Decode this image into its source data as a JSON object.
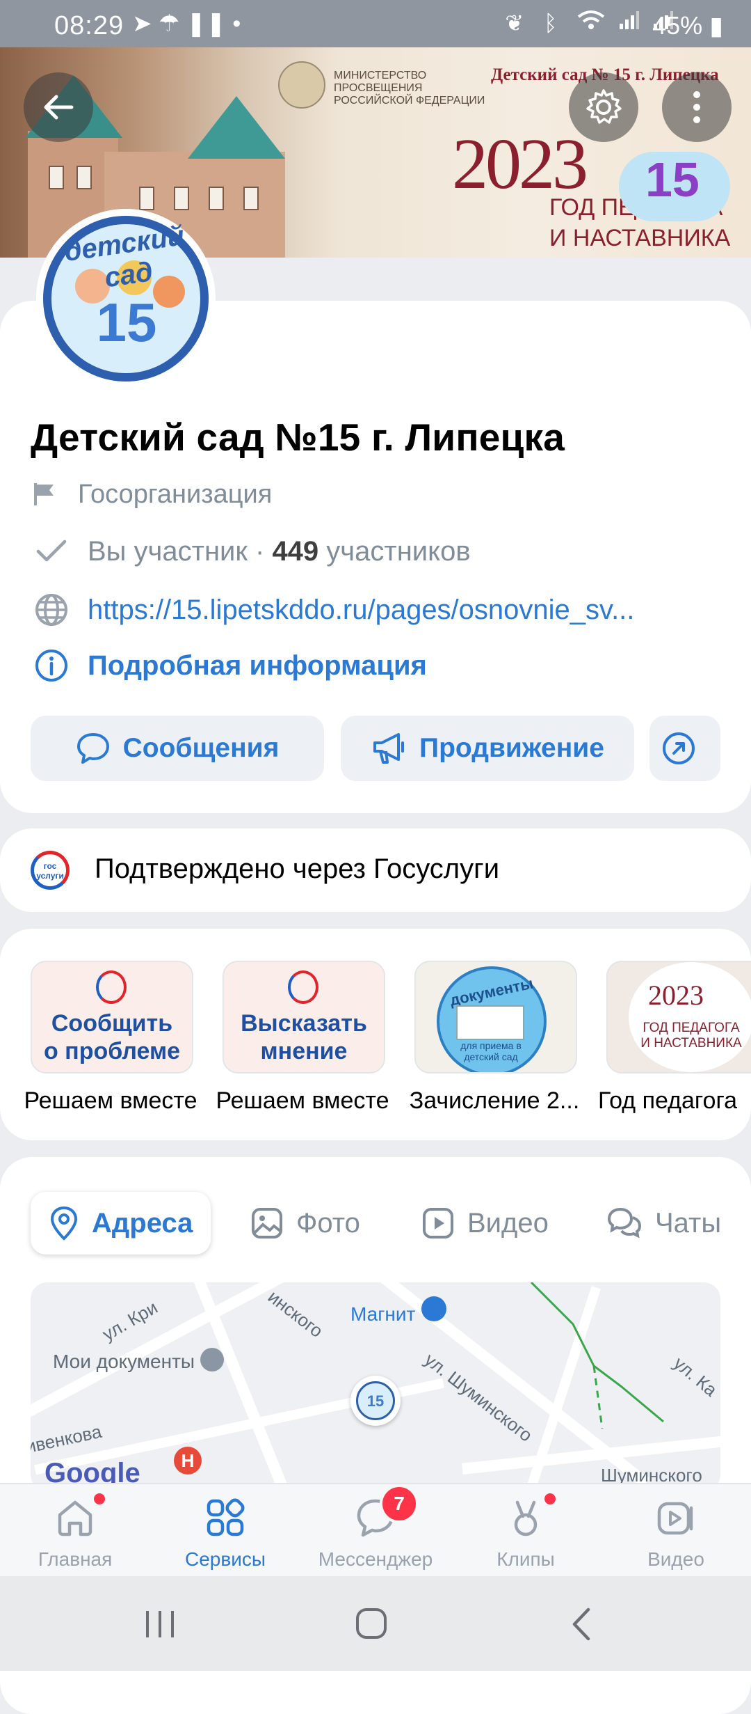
{
  "status_bar": {
    "time": "08:29",
    "battery": "45%",
    "left_icons": [
      "telegram-icon",
      "umbrella-icon",
      "pause-icon",
      "dot-icon"
    ],
    "right_icons": [
      "leaf-icon",
      "bluetooth-icon",
      "wifi-icon",
      "signal-icon",
      "signal-icon"
    ]
  },
  "cover": {
    "ministry": "МИНИСТЕРСТВО ПРОСВЕЩЕНИЯ РОССИЙСКОЙ ФЕДЕРАЦИИ",
    "banner_title": "Детский сад № 15 г. Липецка",
    "year": "2023",
    "year_subtitle_line1": "ГОД ПЕДАГОГА",
    "year_subtitle_line2": "И НАСТАВНИКА",
    "cloud_number": "15"
  },
  "avatar": {
    "word": "детский сад",
    "number": "15"
  },
  "group": {
    "name": "Детский сад №15 г. Липецка",
    "category": "Госорганизация",
    "membership_prefix": "Вы участник · ",
    "members_count": "449",
    "members_suffix": " участников",
    "website": "https://15.lipetskddo.ru/pages/osnovnie_sv...",
    "details_link": "Подробная информация"
  },
  "actions": {
    "messages": "Сообщения",
    "promotion": "Продвижение"
  },
  "verification": {
    "logo_text": "гос услуги",
    "text": "Подтверждено через Госуслуги"
  },
  "services": [
    {
      "card_text_1": "Сообщить",
      "card_text_2": "о проблеме",
      "label": "Решаем вместе"
    },
    {
      "card_text_1": "Высказать",
      "card_text_2": "мнение",
      "label": "Решаем вместе"
    },
    {
      "card_text_1": "документы",
      "card_text_2": "для приема в детский сад",
      "label": "Зачисление 2..."
    },
    {
      "card_text_1": "ГОД ПЕДАГОГА",
      "card_text_2": "И НАСТАВНИКА",
      "label": "Год педагога"
    }
  ],
  "tabs": [
    {
      "label": "Адреса",
      "active": true
    },
    {
      "label": "Фото",
      "active": false
    },
    {
      "label": "Видео",
      "active": false
    },
    {
      "label": "Чаты",
      "active": false
    }
  ],
  "map": {
    "labels": [
      "ул. Кри",
      "инского",
      "Магнит",
      "Мои документы",
      "ивенкова",
      "ул. Шуминского",
      "ул. Ка",
      "Шуминского",
      "Google"
    ],
    "pin_text": "15"
  },
  "bottom_nav": [
    {
      "label": "Главная",
      "icon": "home-icon",
      "active": false,
      "dot": true
    },
    {
      "label": "Сервисы",
      "icon": "services-icon",
      "active": true,
      "dot": false
    },
    {
      "label": "Мессенджер",
      "icon": "messenger-icon",
      "active": false,
      "badge": "7"
    },
    {
      "label": "Клипы",
      "icon": "clips-icon",
      "active": false,
      "dot": true
    },
    {
      "label": "Видео",
      "icon": "video-icon",
      "active": false,
      "dot": false
    }
  ],
  "colors": {
    "accent": "#2a79d4",
    "secondary_text": "#818c99",
    "badge": "#ff3347",
    "brand_red": "#8b1f2d"
  }
}
